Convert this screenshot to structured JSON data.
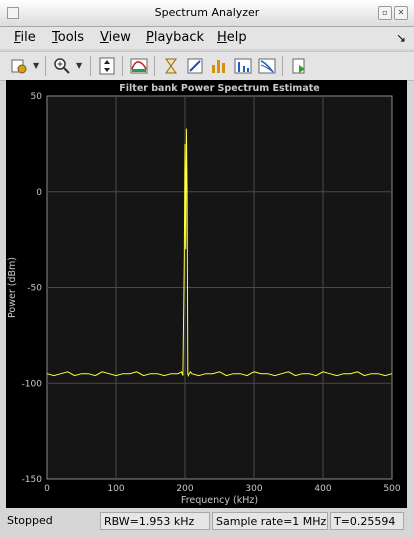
{
  "window": {
    "title": "Spectrum Analyzer"
  },
  "menu": {
    "file": {
      "u": "F",
      "rest": "ile"
    },
    "tools": {
      "u": "T",
      "rest": "ools"
    },
    "view": {
      "u": "V",
      "rest": "iew"
    },
    "playback": {
      "u": "P",
      "rest": "layback"
    },
    "help": {
      "u": "H",
      "rest": "elp"
    }
  },
  "toolbar": {
    "icons": [
      "settings-icon",
      "zoom-icon",
      "autoscale-icon",
      "spectrum-settings-icon",
      "data-cursor-icon",
      "measure-icon",
      "peak-finder-icon",
      "distortion-icon",
      "ccdf-icon",
      "print-to-figure-icon"
    ]
  },
  "colors": {
    "plot_bg": "#000000",
    "axes_bg": "#151515",
    "trace": "#ffff3c",
    "grid": "#4a4a4a",
    "text": "#c8c8c8"
  },
  "chart_data": {
    "type": "line",
    "title": "Filter bank Power Spectrum Estimate",
    "xlabel": "Frequency (kHz)",
    "ylabel": "Power (dBm)",
    "xlim": [
      0,
      500
    ],
    "ylim": [
      -150,
      50
    ],
    "xticks": [
      0,
      100,
      200,
      300,
      400,
      500
    ],
    "yticks": [
      50,
      0,
      -50,
      -100,
      -150
    ],
    "grid": true,
    "series": [
      {
        "x": [
          0,
          10,
          20,
          30,
          40,
          50,
          60,
          70,
          80,
          90,
          100,
          110,
          120,
          130,
          140,
          150,
          160,
          170,
          180,
          190,
          195,
          197,
          199,
          200,
          201,
          202,
          203,
          204,
          205,
          206,
          208,
          210,
          220,
          230,
          240,
          250,
          260,
          270,
          280,
          290,
          300,
          310,
          320,
          330,
          340,
          350,
          360,
          370,
          380,
          390,
          400,
          410,
          420,
          430,
          440,
          450,
          460,
          470,
          480,
          490,
          500
        ],
        "y": [
          -95,
          -96,
          -95,
          -94,
          -96,
          -95,
          -95,
          -96,
          -94,
          -95,
          -96,
          -95,
          -95,
          -94,
          -96,
          -95,
          -95,
          -96,
          -95,
          -95,
          -94,
          -96,
          -35,
          25,
          -30,
          33,
          0,
          -95,
          -96,
          -95,
          -94,
          -95,
          -96,
          -95,
          -95,
          -94,
          -96,
          -95,
          -95,
          -96,
          -94,
          -95,
          -95,
          -96,
          -95,
          -94,
          -96,
          -95,
          -95,
          -96,
          -94,
          -95,
          -96,
          -95,
          -95,
          -94,
          -96,
          -95,
          -95,
          -96,
          -95
        ]
      }
    ]
  },
  "status": {
    "state": "Stopped",
    "rbw": "RBW=1.953 kHz",
    "sample_rate": "Sample rate=1 MHz",
    "time": "T=0.25594"
  }
}
